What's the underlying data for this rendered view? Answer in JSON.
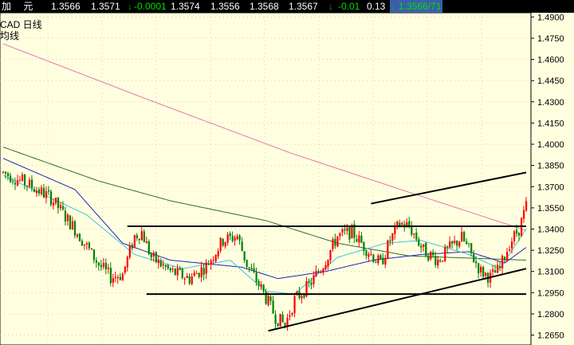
{
  "quote": {
    "name": "加  元",
    "open": "1.3566",
    "high": "1.3571",
    "change_arrow": "↓",
    "change": "-0.0001",
    "v1": "1.3574",
    "v2": "1.3556",
    "v3": "1.3568",
    "v4": "1.3567",
    "arrow2": "↓",
    "chg2": "-0.01",
    "pct": "0.13",
    "arrow3": "↓",
    "last": "1.3566/71"
  },
  "chart_labels": {
    "symbol": "CAD  日线",
    "period": "均线"
  },
  "colors": {
    "background": "#ffffe0",
    "bull_candle": "#ff0000",
    "bear_candle": "#008000",
    "ma_pink": "#e07ab0",
    "ma_green": "#2e6e2e",
    "ma_blue": "#2020c0",
    "ma_cyan": "#40c0e0",
    "trendline": "#000000"
  },
  "chart_data": {
    "type": "candlestick",
    "y_axis": {
      "ticks": [
        "1.4900",
        "1.4750",
        "1.4600",
        "1.4450",
        "1.4300",
        "1.4150",
        "1.4000",
        "1.3850",
        "1.3700",
        "1.3550",
        "1.3400",
        "1.3250",
        "1.3100",
        "1.2950",
        "1.2800",
        "1.2650"
      ],
      "range": [
        1.258,
        1.493
      ]
    },
    "grid": true,
    "seed": 7,
    "trend_points": [
      [
        0,
        1.38
      ],
      [
        10,
        1.372
      ],
      [
        20,
        1.362
      ],
      [
        30,
        1.34
      ],
      [
        40,
        1.315
      ],
      [
        45,
        1.306
      ],
      [
        50,
        1.308
      ],
      [
        55,
        1.335
      ],
      [
        58,
        1.338
      ],
      [
        62,
        1.32
      ],
      [
        70,
        1.31
      ],
      [
        78,
        1.305
      ],
      [
        85,
        1.314
      ],
      [
        92,
        1.332
      ],
      [
        98,
        1.335
      ],
      [
        102,
        1.315
      ],
      [
        108,
        1.298
      ],
      [
        114,
        1.278
      ],
      [
        118,
        1.272
      ],
      [
        122,
        1.29
      ],
      [
        128,
        1.3
      ],
      [
        134,
        1.315
      ],
      [
        140,
        1.335
      ],
      [
        146,
        1.338
      ],
      [
        152,
        1.326
      ],
      [
        158,
        1.315
      ],
      [
        162,
        1.332
      ],
      [
        166,
        1.344
      ],
      [
        170,
        1.342
      ],
      [
        176,
        1.325
      ],
      [
        182,
        1.318
      ],
      [
        188,
        1.328
      ],
      [
        192,
        1.334
      ],
      [
        196,
        1.322
      ],
      [
        200,
        1.31
      ],
      [
        204,
        1.306
      ],
      [
        208,
        1.312
      ],
      [
        212,
        1.33
      ],
      [
        216,
        1.34
      ],
      [
        219,
        1.356
      ]
    ],
    "moving_averages": [
      {
        "color_key": "ma_pink",
        "points": [
          [
            0,
            1.471
          ],
          [
            60,
            1.432
          ],
          [
            120,
            1.394
          ],
          [
            170,
            1.366
          ],
          [
            219,
            1.339
          ]
        ]
      },
      {
        "color_key": "ma_green",
        "points": [
          [
            0,
            1.398
          ],
          [
            40,
            1.374
          ],
          [
            70,
            1.36
          ],
          [
            110,
            1.346
          ],
          [
            140,
            1.33
          ],
          [
            170,
            1.321
          ],
          [
            219,
            1.318
          ]
        ]
      },
      {
        "color_key": "ma_blue",
        "points": [
          [
            0,
            1.39
          ],
          [
            30,
            1.368
          ],
          [
            50,
            1.33
          ],
          [
            70,
            1.318
          ],
          [
            100,
            1.313
          ],
          [
            115,
            1.305
          ],
          [
            135,
            1.31
          ],
          [
            155,
            1.318
          ],
          [
            175,
            1.322
          ],
          [
            195,
            1.324
          ],
          [
            210,
            1.316
          ],
          [
            219,
            1.327
          ]
        ]
      },
      {
        "color_key": "ma_cyan",
        "points": [
          [
            0,
            1.378
          ],
          [
            35,
            1.35
          ],
          [
            55,
            1.322
          ],
          [
            75,
            1.312
          ],
          [
            95,
            1.318
          ],
          [
            110,
            1.296
          ],
          [
            122,
            1.294
          ],
          [
            140,
            1.32
          ],
          [
            160,
            1.33
          ],
          [
            175,
            1.332
          ],
          [
            195,
            1.322
          ],
          [
            208,
            1.312
          ],
          [
            219,
            1.34
          ]
        ]
      }
    ],
    "lines": [
      {
        "name": "resistance",
        "from": [
          52,
          1.342
        ],
        "to": [
          219,
          1.342
        ]
      },
      {
        "name": "support",
        "from": [
          60,
          1.294
        ],
        "to": [
          219,
          1.294
        ]
      },
      {
        "name": "lower-channel",
        "from": [
          111,
          1.268
        ],
        "to": [
          219,
          1.312
        ]
      },
      {
        "name": "upper-channel",
        "from": [
          154,
          1.358
        ],
        "to": [
          219,
          1.38
        ]
      }
    ]
  }
}
